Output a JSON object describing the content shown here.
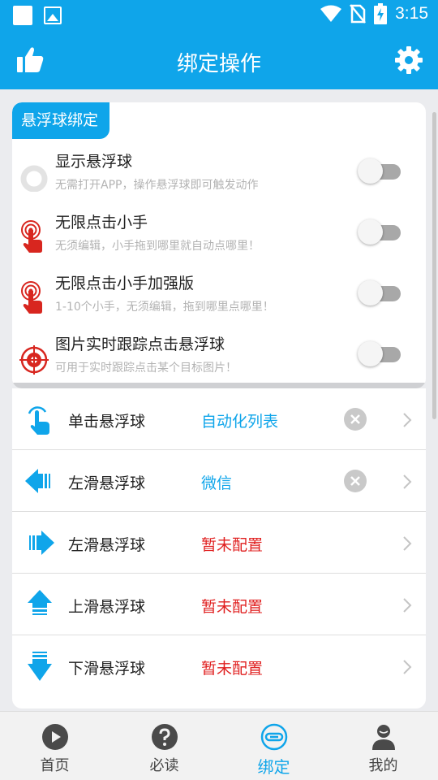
{
  "status_bar": {
    "time": "3:15"
  },
  "header": {
    "title": "绑定操作"
  },
  "float_ball_section": {
    "tag": "悬浮球绑定",
    "features": [
      {
        "title": "显示悬浮球",
        "desc": "无需打开APP，操作悬浮球即可触发动作",
        "icon": "ring-icon",
        "enabled": false
      },
      {
        "title": "无限点击小手",
        "desc": "无须编辑，小手拖到哪里就自动点哪里！",
        "icon": "tap-hand-icon",
        "enabled": false
      },
      {
        "title": "无限点击小手加强版",
        "desc": "1-10个小手，无须编辑，拖到哪里点哪里！",
        "icon": "tap-hand-icon",
        "enabled": false
      },
      {
        "title": "图片实时跟踪点击悬浮球",
        "desc": "可用于实时跟踪点击某个目标图片！",
        "icon": "crosshair-target-icon",
        "enabled": false
      }
    ]
  },
  "bindings": [
    {
      "label": "单击悬浮球",
      "value": "自动化列表",
      "configured": true
    },
    {
      "label": "左滑悬浮球",
      "value": "微信",
      "configured": true
    },
    {
      "label": "左滑悬浮球",
      "value": "暂未配置",
      "configured": false
    },
    {
      "label": "上滑悬浮球",
      "value": "暂未配置",
      "configured": false
    },
    {
      "label": "下滑悬浮球",
      "value": "暂未配置",
      "configured": false
    }
  ],
  "bottom_nav": [
    {
      "label": "首页",
      "icon": "play-circle-icon",
      "active": false
    },
    {
      "label": "必读",
      "icon": "question-circle-icon",
      "active": false
    },
    {
      "label": "绑定",
      "icon": "link-circle-icon",
      "active": true
    },
    {
      "label": "我的",
      "icon": "user-icon",
      "active": false
    }
  ],
  "colors": {
    "primary": "#0fa5ea",
    "configured_value": "#0fa5ea",
    "unconfigured_value": "#e02020",
    "target_red": "#d8261f"
  }
}
